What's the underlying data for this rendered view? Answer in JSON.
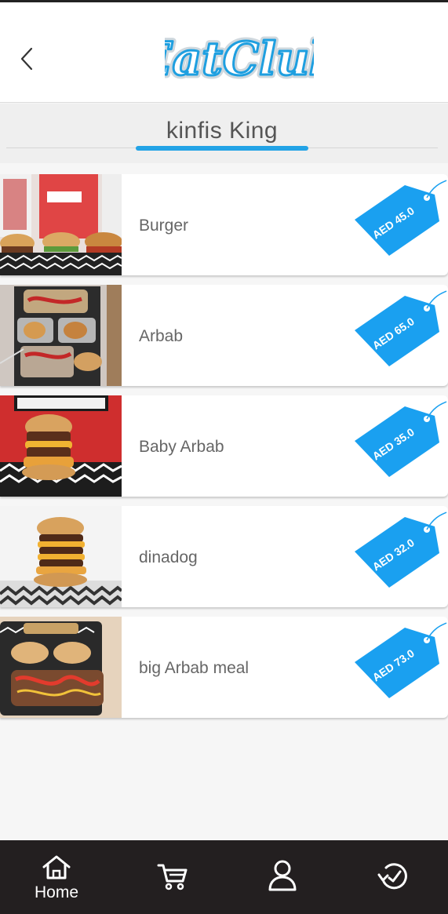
{
  "app": {
    "logo_text": "EatClub"
  },
  "header": {
    "back_icon": "chevron-left-icon"
  },
  "store": {
    "title": "kinfis King"
  },
  "items": [
    {
      "name": "Burger",
      "price": "AED 45.0"
    },
    {
      "name": "Arbab",
      "price": "AED 65.0"
    },
    {
      "name": "Baby Arbab",
      "price": "AED 35.0"
    },
    {
      "name": "dinadog",
      "price": "AED 32.0"
    },
    {
      "name": "big Arbab meal",
      "price": "AED 73.0"
    }
  ],
  "colors": {
    "accent": "#23a3e6",
    "tag": "#1aa0f0",
    "nav_bg": "#231f20"
  },
  "nav": {
    "home_label": "Home",
    "icons": [
      "home-icon",
      "cart-icon",
      "user-icon",
      "history-icon"
    ]
  }
}
